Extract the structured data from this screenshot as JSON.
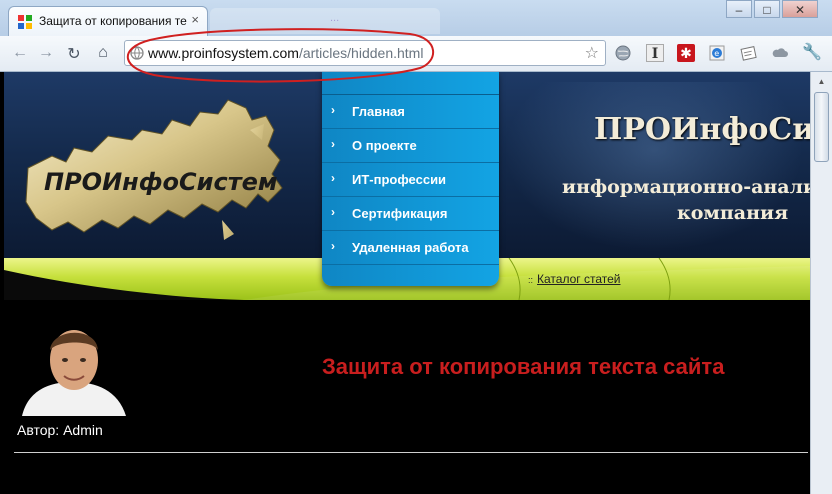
{
  "browser": {
    "tab_title": "Защита от копирования те",
    "tab_close": "×",
    "ghost_tab_text": "...",
    "window_minimize": "–",
    "window_maximize": "□",
    "window_close": "✕",
    "url_host": "www.proinfosystem.com",
    "url_path": "/articles/hidden.html",
    "bookmark_star": "☆",
    "icons": [
      "back-arrow-icon",
      "forward-arrow-icon",
      "reload-icon",
      "home-icon",
      "globe-icon",
      "star-icon",
      "extension-i-icon",
      "extension-red-icon",
      "extension-ie-icon",
      "extension-note-icon",
      "cloud-icon",
      "wrench-icon"
    ]
  },
  "site": {
    "logo_text": "ПРОИнфоСистем",
    "name": "ПРОИнфоСист",
    "slogan_line1": "информационно-аналит",
    "slogan_line2": "компания",
    "menu": [
      {
        "label": "Главная"
      },
      {
        "label": "О проекте"
      },
      {
        "label": "ИТ-профессии"
      },
      {
        "label": "Сертификация"
      },
      {
        "label": "Удаленная работа"
      }
    ],
    "catalog_bullet": "::",
    "catalog_link": "Каталог статей"
  },
  "article": {
    "title": "Защита от копирования текста сайта",
    "author": "Автор: Admin"
  },
  "colors": {
    "header_bg": "#1e3a66",
    "menu_bg": "#13a4e4",
    "green_bar": "#c6e03c",
    "title_red": "#c81e1e",
    "annotation_red": "#d02020"
  }
}
